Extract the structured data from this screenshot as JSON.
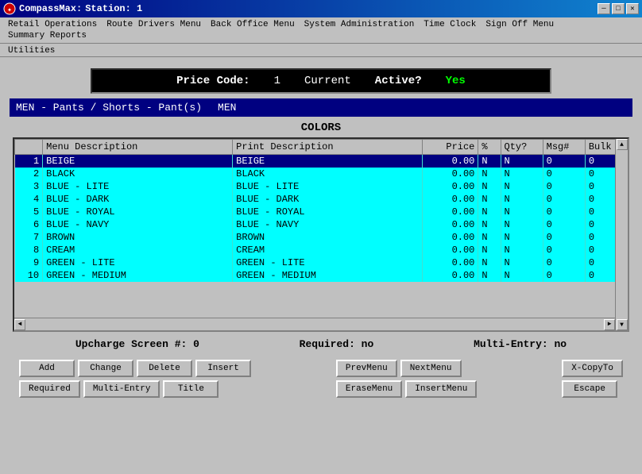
{
  "titleBar": {
    "appName": "CompassMax:",
    "stationLabel": "Station: 1",
    "minBtn": "─",
    "maxBtn": "□",
    "closeBtn": "✕"
  },
  "menuBar": {
    "items": [
      "Retail Operations",
      "Route Drivers Menu",
      "Back Office Menu",
      "System Administration",
      "Time Clock",
      "Sign Off Menu",
      "Summary Reports"
    ]
  },
  "utilitiesBar": {
    "label": "Utilities"
  },
  "priceCode": {
    "label": "Price Code:",
    "value": "1",
    "currentLabel": "Current",
    "activeLabel": "Active?",
    "activeValue": "Yes"
  },
  "categoryBar": {
    "category": "MEN - Pants / Shorts - Pant(s)",
    "code": "MEN"
  },
  "colorsTitle": "COLORS",
  "tableHeaders": [
    {
      "label": "",
      "class": "col-num"
    },
    {
      "label": "Menu Description",
      "class": "col-menu"
    },
    {
      "label": "Print Description",
      "class": "col-print"
    },
    {
      "label": "Price",
      "class": "col-price"
    },
    {
      "label": "%",
      "class": "col-pct"
    },
    {
      "label": "Qty?",
      "class": "col-qty"
    },
    {
      "label": "Msg#",
      "class": "col-msg"
    },
    {
      "label": "Bulk",
      "class": "col-bulk"
    }
  ],
  "tableRows": [
    {
      "num": 1,
      "menu": "BEIGE",
      "print": "BEIGE",
      "price": "0.00",
      "pct": "N",
      "qty": "N",
      "msg": "0",
      "bulk": "0",
      "selected": true
    },
    {
      "num": 2,
      "menu": "BLACK",
      "print": "BLACK",
      "price": "0.00",
      "pct": "N",
      "qty": "N",
      "msg": "0",
      "bulk": "0",
      "selected": false
    },
    {
      "num": 3,
      "menu": "BLUE - LITE",
      "print": "BLUE - LITE",
      "price": "0.00",
      "pct": "N",
      "qty": "N",
      "msg": "0",
      "bulk": "0",
      "selected": false
    },
    {
      "num": 4,
      "menu": "BLUE - DARK",
      "print": "BLUE - DARK",
      "price": "0.00",
      "pct": "N",
      "qty": "N",
      "msg": "0",
      "bulk": "0",
      "selected": false
    },
    {
      "num": 5,
      "menu": "BLUE - ROYAL",
      "print": "BLUE - ROYAL",
      "price": "0.00",
      "pct": "N",
      "qty": "N",
      "msg": "0",
      "bulk": "0",
      "selected": false
    },
    {
      "num": 6,
      "menu": "BLUE - NAVY",
      "print": "BLUE - NAVY",
      "price": "0.00",
      "pct": "N",
      "qty": "N",
      "msg": "0",
      "bulk": "0",
      "selected": false
    },
    {
      "num": 7,
      "menu": "BROWN",
      "print": "BROWN",
      "price": "0.00",
      "pct": "N",
      "qty": "N",
      "msg": "0",
      "bulk": "0",
      "selected": false
    },
    {
      "num": 8,
      "menu": "CREAM",
      "print": "CREAM",
      "price": "0.00",
      "pct": "N",
      "qty": "N",
      "msg": "0",
      "bulk": "0",
      "selected": false
    },
    {
      "num": 9,
      "menu": "GREEN - LITE",
      "print": "GREEN - LITE",
      "price": "0.00",
      "pct": "N",
      "qty": "N",
      "msg": "0",
      "bulk": "0",
      "selected": false
    },
    {
      "num": 10,
      "menu": "GREEN - MEDIUM",
      "print": "GREEN - MEDIUM",
      "price": "0.00",
      "pct": "N",
      "qty": "N",
      "msg": "0",
      "bulk": "0",
      "selected": false
    }
  ],
  "statusBar": {
    "upcharge": "Upcharge Screen #: 0",
    "required": "Required: no",
    "multiEntry": "Multi-Entry: no"
  },
  "buttons": {
    "row1": [
      "Add",
      "Change",
      "Delete",
      "Insert"
    ],
    "row2": [
      "Required",
      "Multi-Entry",
      "Title"
    ],
    "mid1": [
      "PrevMenu",
      "NextMenu"
    ],
    "mid2": [
      "EraseMenu",
      "InsertMenu"
    ],
    "right": [
      "X-CopyTo",
      "Escape"
    ]
  }
}
